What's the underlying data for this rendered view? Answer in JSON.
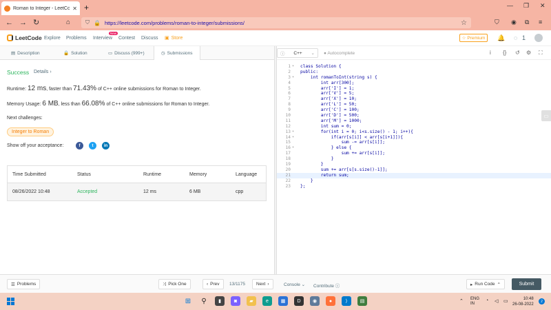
{
  "browser": {
    "tab_title": "Roman to Integer - LeetCode",
    "new_tab": "+",
    "url": "https://leetcode.com/problems/roman-to-integer/submissions/"
  },
  "header": {
    "logo": "LeetCode",
    "nav": [
      "Explore",
      "Problems",
      "Interview",
      "Contest",
      "Discuss"
    ],
    "new_badge": "New",
    "store": "Store",
    "premium": "Premium",
    "notifications": "1"
  },
  "left_tabs": [
    "Description",
    "Solution",
    "Discuss (999+)",
    "Submissions"
  ],
  "result": {
    "status": "Success",
    "details": "Details ›",
    "runtime_label": "Runtime:",
    "runtime_value": "12 ms",
    "runtime_mid": ", faster than",
    "runtime_pct": "71.43%",
    "runtime_tail": "of C++ online submissions for Roman to Integer.",
    "memory_label": "Memory Usage:",
    "memory_value": "6 MB",
    "memory_mid": ", less than",
    "memory_pct": "66.08%",
    "memory_tail": "of C++ online submissions for Roman to Integer.",
    "next_challenges": "Next challenges:",
    "challenge": "Integer to Roman",
    "show_off": "Show off your acceptance:"
  },
  "table": {
    "headers": [
      "Time Submitted",
      "Status",
      "Runtime",
      "Memory",
      "Language"
    ],
    "rows": [
      [
        "08/26/2022 10:48",
        "Accepted",
        "12 ms",
        "6 MB",
        "cpp"
      ]
    ]
  },
  "editor": {
    "language": "C++",
    "autocomplete": "Autocomplete",
    "lines": [
      "class Solution {",
      "public:",
      "    int romanToInt(string s) {",
      "        int arr[300];",
      "        arr['I'] = 1;",
      "        arr['V'] = 5;",
      "        arr['X'] = 10;",
      "        arr['L'] = 50;",
      "        arr['C'] = 100;",
      "        arr['D'] = 500;",
      "        arr['M'] = 1000;",
      "        int sum = 0;",
      "        for(int i = 0; i<s.size() - 1; i++){",
      "            if(arr[s[i]] < arr[s[i+1]]){",
      "                sum -= arr[s[i]];",
      "            } else {",
      "                sum += arr[s[i]];",
      "            }",
      "        }",
      "        sum += arr[s[s.size()-1]];",
      "        return sum;",
      "    }",
      "};"
    ],
    "line_numbers": [
      "1",
      "2",
      "3",
      "4",
      "5",
      "6",
      "7",
      "8",
      "9",
      "10",
      "11",
      "12",
      "13",
      "14",
      "15",
      "16",
      "17",
      "18",
      "19",
      "20",
      "21",
      "22",
      "23"
    ]
  },
  "footer": {
    "problems": "Problems",
    "pick_one": "Pick One",
    "prev": "Prev",
    "page": "/1175",
    "next": "Next",
    "console": "Console",
    "contribute": "Contribute",
    "run_code": "Run Code",
    "submit": "Submit"
  },
  "taskbar": {
    "lang": "ENG",
    "region": "IN",
    "time": "10:48",
    "date": "26-08-2022",
    "notif_count": "2"
  },
  "colors": {
    "browser_chrome": "#f6b5a4",
    "success": "#2db55d",
    "brand_orange": "#f89f1b",
    "submit": "#455a64"
  }
}
